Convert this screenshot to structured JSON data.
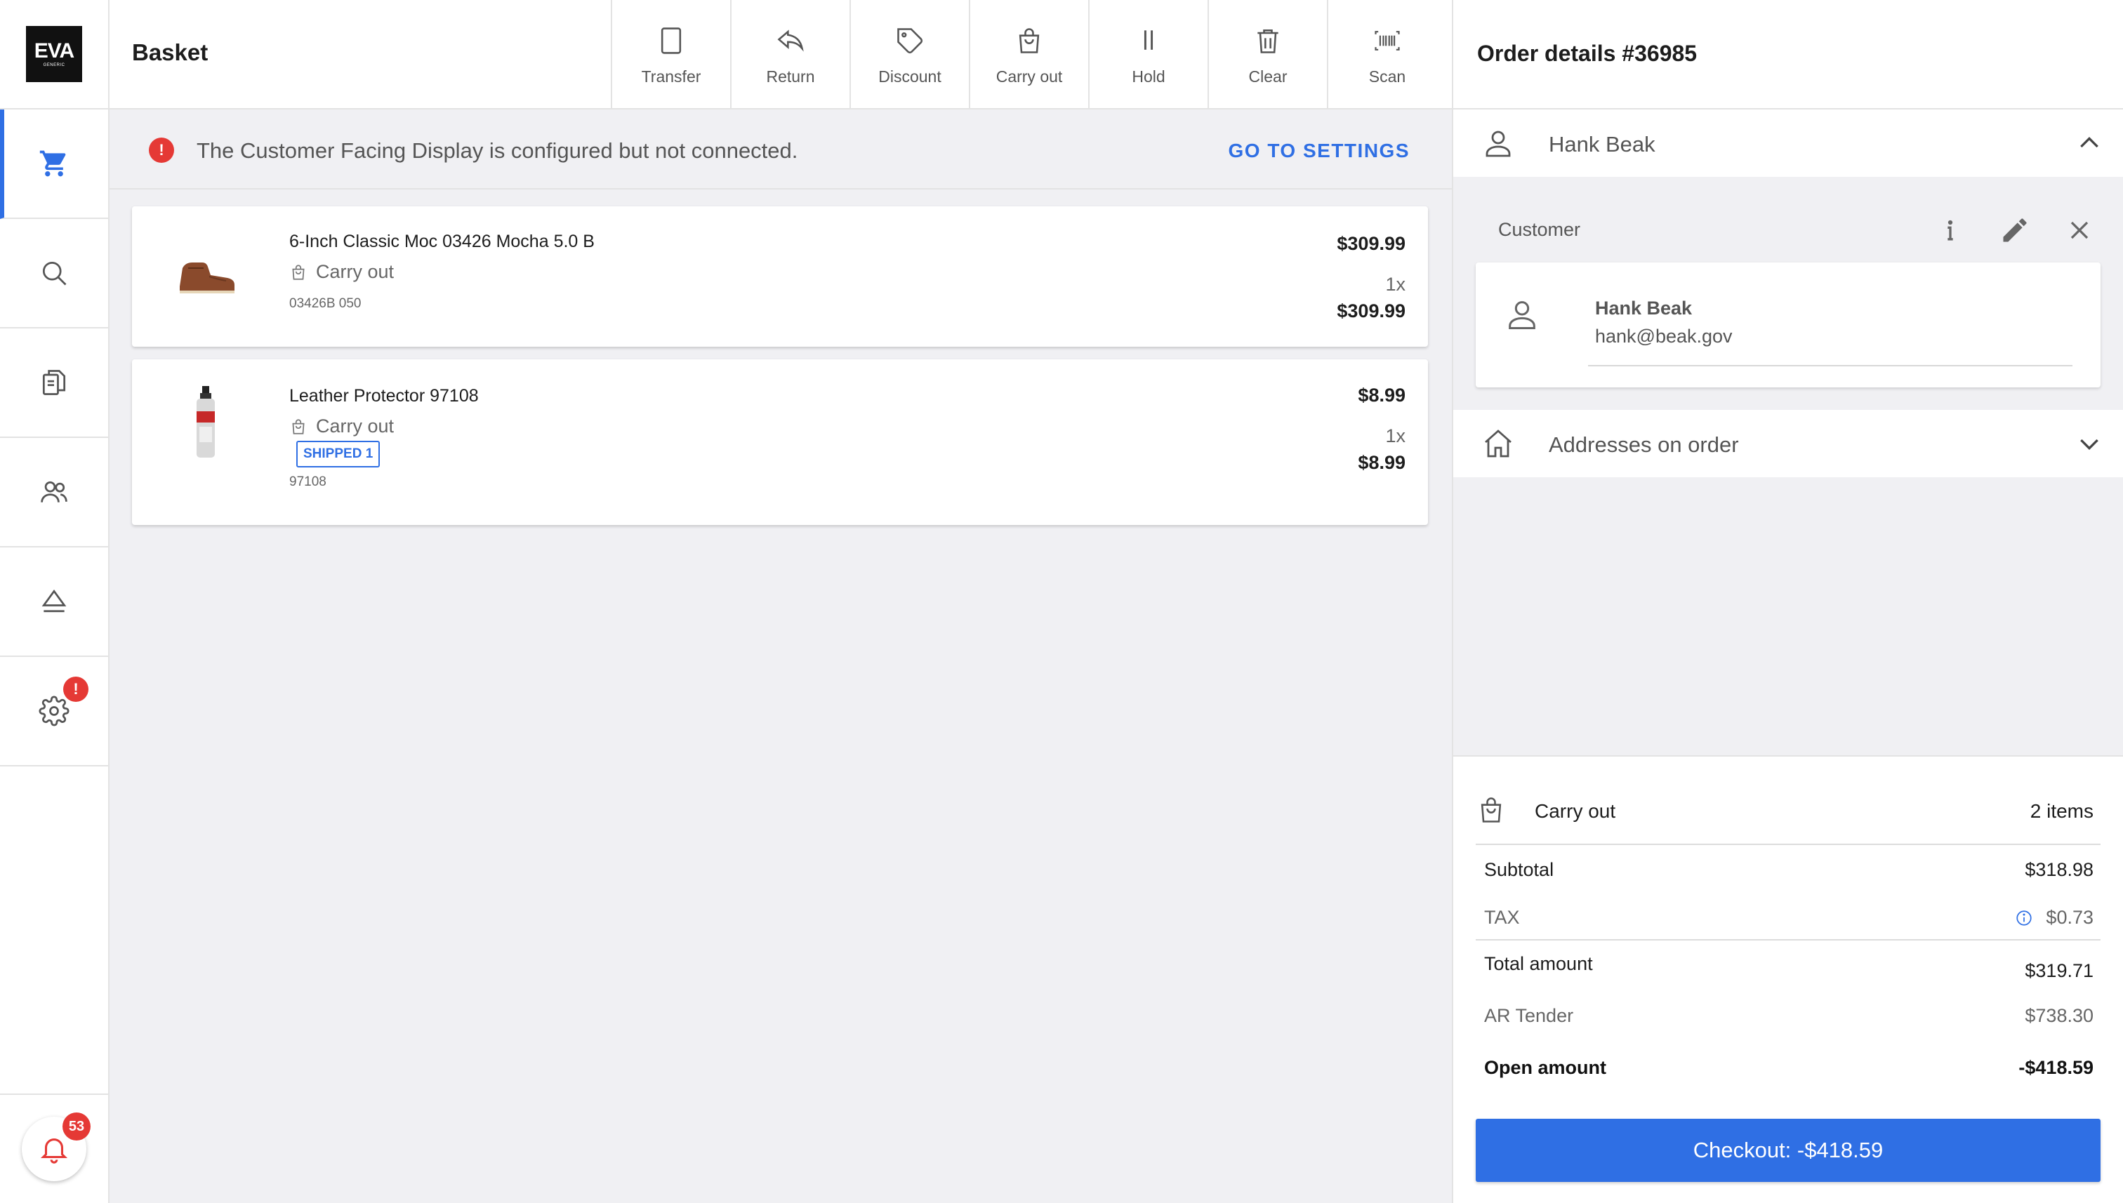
{
  "app": {
    "logo_text": "EVA",
    "logo_subtext": "GENERIC"
  },
  "sidebar": {
    "items": [
      {
        "name": "cart",
        "icon": "cart-icon",
        "active": true
      },
      {
        "name": "search",
        "icon": "search-icon"
      },
      {
        "name": "orders",
        "icon": "documents-icon"
      },
      {
        "name": "customers",
        "icon": "users-icon"
      },
      {
        "name": "eject",
        "icon": "eject-icon"
      },
      {
        "name": "settings",
        "icon": "gear-icon",
        "alert": "!"
      }
    ],
    "notifications_count": "53"
  },
  "header": {
    "title": "Basket"
  },
  "toolbar": {
    "buttons": [
      {
        "label": "Transfer",
        "icon": "tablet-icon"
      },
      {
        "label": "Return",
        "icon": "return-arrow-icon"
      },
      {
        "label": "Discount",
        "icon": "tag-icon"
      },
      {
        "label": "Carry out",
        "icon": "bag-icon"
      },
      {
        "label": "Hold",
        "icon": "pause-icon"
      },
      {
        "label": "Clear",
        "icon": "trash-icon"
      },
      {
        "label": "Scan",
        "icon": "barcode-icon"
      }
    ]
  },
  "alert": {
    "icon_text": "!",
    "message": "The Customer Facing Display is configured but not connected.",
    "action": "GO TO SETTINGS"
  },
  "basket": {
    "lines": [
      {
        "name": "6-Inch Classic Moc 03426 Mocha 5.0 B",
        "delivery": "Carry out",
        "code": "03426B 050",
        "unit_price": "$309.99",
        "quantity": "1x",
        "total": "$309.99",
        "image": "boot-image"
      },
      {
        "name": "Leather Protector 97108",
        "delivery": "Carry out",
        "badge": "SHIPPED 1",
        "code": "97108",
        "unit_price": "$8.99",
        "quantity": "1x",
        "total": "$8.99",
        "image": "spray-bottle-image"
      }
    ]
  },
  "order": {
    "title": "Order details #36985",
    "customer_header": "Hank Beak",
    "customer_section_label": "Customer",
    "customer": {
      "name": "Hank Beak",
      "email": "hank@beak.gov"
    },
    "addresses_label": "Addresses on order"
  },
  "summary": {
    "delivery_mode": "Carry out",
    "item_count": "2 items",
    "subtotal_label": "Subtotal",
    "subtotal": "$318.98",
    "tax_label": "TAX",
    "tax": "$0.73",
    "total_label": "Total amount",
    "total": "$319.71",
    "tender_label": "AR Tender",
    "tender": "$738.30",
    "open_label": "Open amount",
    "open": "-$418.59",
    "checkout_label": "Checkout: -$418.59"
  },
  "colors": {
    "accent": "#2f6fe4",
    "alert": "#e53935",
    "background": "#f0f0f3"
  }
}
